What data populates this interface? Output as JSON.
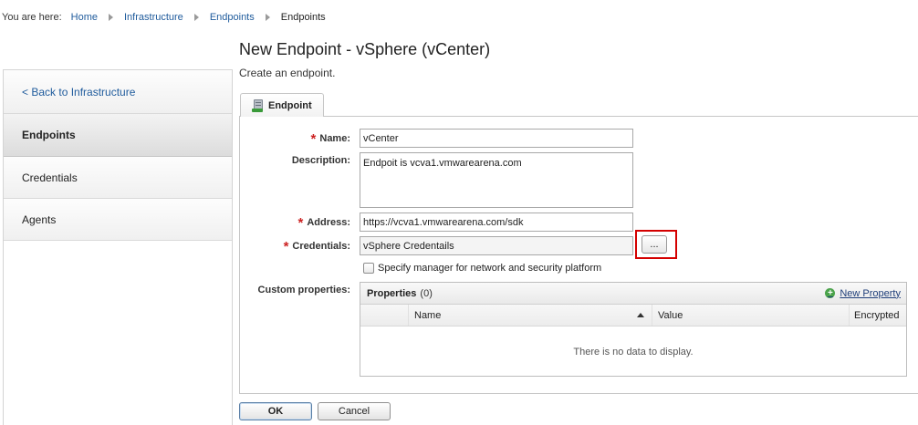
{
  "breadcrumb": {
    "label": "You are here:",
    "items": [
      "Home",
      "Infrastructure",
      "Endpoints"
    ],
    "current": "Endpoints"
  },
  "page": {
    "title": "New Endpoint - vSphere (vCenter)",
    "subtitle": "Create an endpoint."
  },
  "sidebar": {
    "back": "< Back to Infrastructure",
    "items": [
      {
        "label": "Endpoints",
        "active": true
      },
      {
        "label": "Credentials",
        "active": false
      },
      {
        "label": "Agents",
        "active": false
      }
    ]
  },
  "tab": {
    "label": "Endpoint",
    "icon": "server-endpoint-icon"
  },
  "form": {
    "name_label": "Name:",
    "name_value": "vCenter",
    "description_label": "Description:",
    "description_value": "Endpoit is vcva1.vmwarearena.com",
    "address_label": "Address:",
    "address_value": "https://vcva1.vmwarearena.com/sdk",
    "credentials_label": "Credentials:",
    "credentials_value": "vSphere Credentails",
    "browse_label": "...",
    "checkbox_label": "Specify manager for network and security platform",
    "checkbox_checked": false,
    "custom_props_label": "Custom properties:",
    "required_mark": "*"
  },
  "properties": {
    "title": "Properties",
    "count": "(0)",
    "new_property": "New Property",
    "columns": [
      "Name",
      "Value",
      "Encrypted"
    ],
    "empty": "There is no data to display."
  },
  "buttons": {
    "ok": "OK",
    "cancel": "Cancel"
  },
  "colors": {
    "link": "#1f5b9c",
    "required": "#cc2222",
    "highlight": "#d40000"
  }
}
